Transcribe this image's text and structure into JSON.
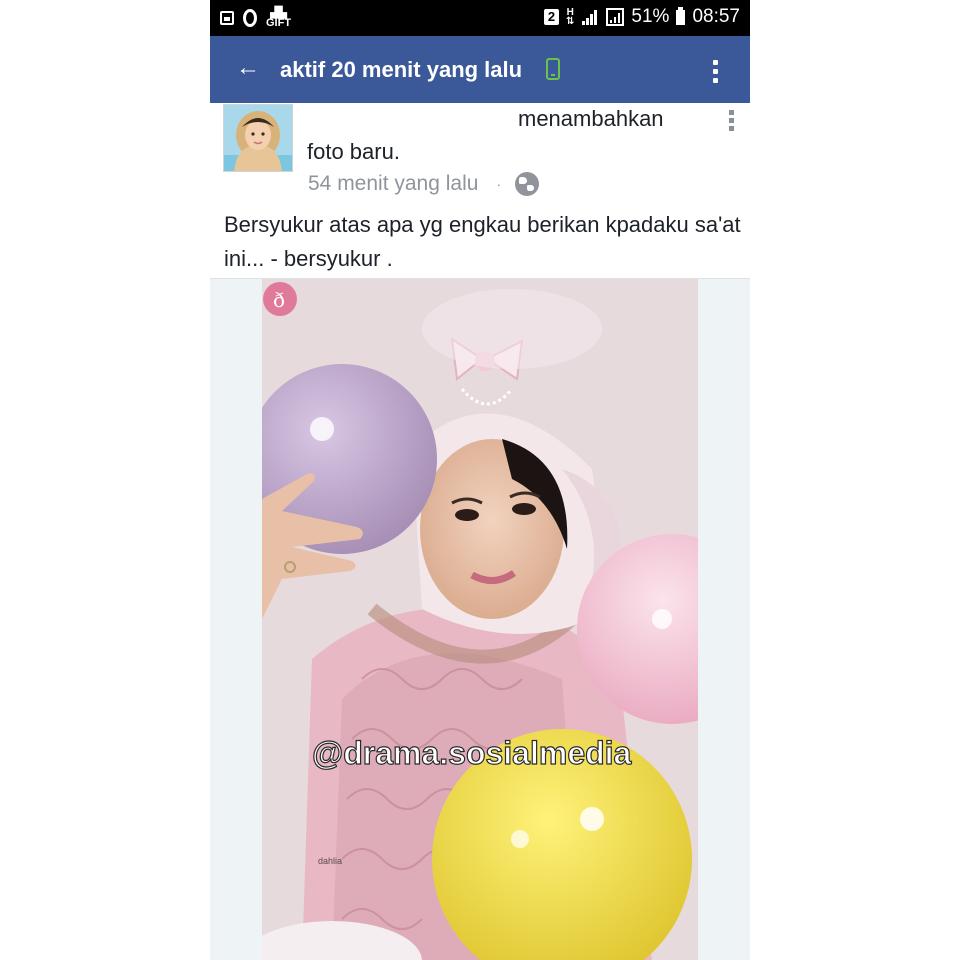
{
  "status_bar": {
    "notification_icons": [
      "gallery-icon",
      "opera-icon",
      "gift-icon"
    ],
    "sim_badge": "2",
    "network_type": "H",
    "battery_percent": "51%",
    "time": "08:57"
  },
  "app_bar": {
    "title": "aktif 20 menit yang lalu",
    "back_icon": "arrow-left-icon",
    "device_icon": "mobile-phone-icon",
    "menu_icon": "more-vert-icon",
    "color": "#3b5998",
    "device_icon_color": "#6cc24a"
  },
  "post": {
    "headline_tail": "menambahkan",
    "headline_line2": "foto baru.",
    "time": "54 menit yang lalu",
    "separator": "·",
    "privacy_icon": "globe-icon",
    "caption": "Bersyukur atas apa yg engkau berikan kpadaku sa'at ini... - bersyukur .",
    "photo": {
      "watermark": "@drama.sosialmedia",
      "small_label": "dahlia"
    }
  }
}
